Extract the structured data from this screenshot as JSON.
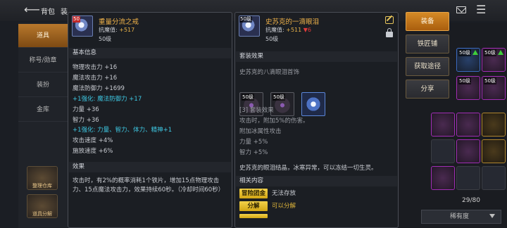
{
  "topbar": {
    "back_icon": "back-arrow-icon",
    "title": "背包",
    "title_suffix": "装"
  },
  "left_nav": {
    "items": [
      {
        "label": "道具",
        "active": true
      },
      {
        "label": "称号/勋章",
        "active": false
      },
      {
        "label": "装扮",
        "active": false
      },
      {
        "label": "金库",
        "active": false
      }
    ],
    "tools": [
      "整理仓库",
      "道具分解"
    ]
  },
  "inventory": {
    "count": "29/80",
    "sort_label": "稀有度",
    "slot_levels": [
      "50级",
      "50级",
      "50级",
      "50级",
      "50级",
      "50级"
    ]
  },
  "tooltip_equipped": {
    "level_badge": "50",
    "name": "重量分流之戒",
    "sub_prefix": "抗魔值:",
    "sub_value": "+517",
    "level": "50级",
    "basic_header": "基本信息",
    "stats": [
      "物理攻击力 +16",
      "魔法攻击力 +16",
      "魔法防御力 +1699"
    ],
    "enhance_1": "+1强化: 魔法防御力 +17",
    "stats2": [
      "力量 +36",
      "智力 +36"
    ],
    "enhance_2": "+1强化: 力量、智力、体力、精神+1",
    "stats3": [
      "攻击速度 +4%",
      "施放速度 +6%"
    ],
    "effect_header": "效果",
    "effect_text": "攻击时，有2%的概率消耗1个铁片，增加15点物理攻击力、15点魔法攻击力，效果持续60秒。（冷却时间60秒）"
  },
  "tooltip_item": {
    "level_badge": "50级",
    "name": "史苏克的一滴眼泪",
    "sub_prefix": "抗魔值:",
    "sub_value": "+511",
    "sub_diff": "▼6",
    "level": "50级",
    "set_header": "套装效果",
    "set_name": "史苏克的八滴眼泪首饰",
    "set_slot_levels": [
      "50级",
      "50级",
      ""
    ],
    "set_effect_title": "[3] 套装效果",
    "set_effect_lines": [
      "攻击时，附加5%的伤害。",
      "附加冰属性攻击",
      "力量 +5%",
      "智力 +5%"
    ],
    "flavor_text": "史苏克的眼泪结晶，冰寒异常，可以冻结一切生灵。",
    "related_header": "相关内容",
    "tags": [
      {
        "label": "冒险团金库",
        "status": "无法存放",
        "status_color": "#c9ccd2"
      },
      {
        "label": "分解",
        "status": "可以分解",
        "status_color": "#e0b63a"
      }
    ]
  },
  "actions": {
    "equip": "装备",
    "smith": "铁匠铺",
    "obtain": "获取途径",
    "share": "分享"
  },
  "colors": {
    "accent_orange": "#d58a26",
    "item_name": "#f0b34a",
    "enhance_cyan": "#3ec8e3",
    "tag_yellow": "#e0b63a",
    "down_red": "#e23b3b"
  }
}
